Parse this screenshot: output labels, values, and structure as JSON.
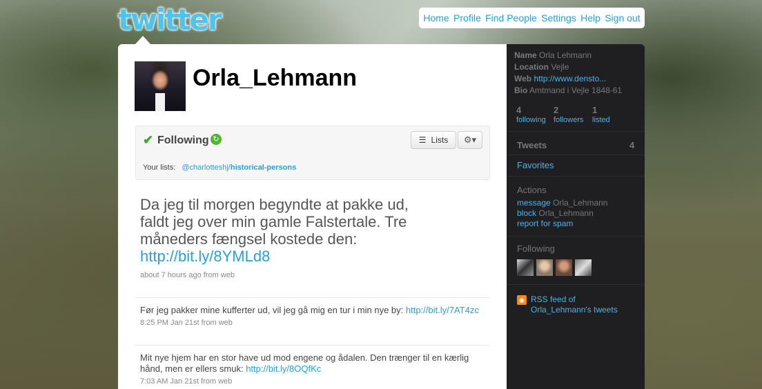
{
  "logo": "twitter",
  "nav": [
    "Home",
    "Profile",
    "Find People",
    "Settings",
    "Help",
    "Sign out"
  ],
  "profile": {
    "screen_name": "Orla_Lehmann"
  },
  "follow": {
    "status": "Following",
    "lists_button": "Lists",
    "your_lists_label": "Your lists:",
    "list_user": "@charlotteshj/",
    "list_name": "historical-persons"
  },
  "latest_tweet": {
    "text": "Da jeg til morgen begyndte at pakke ud, faldt jeg over min gamle Falstertale. Tre måneders fængsel kostede den: ",
    "link": "http://bit.ly/8YMLd8",
    "meta": "about 7 hours ago from web"
  },
  "tweets": [
    {
      "text": "Før jeg pakker mine kufferter ud, vil jeg gå mig en tur i min nye by: ",
      "link": "http://bit.ly/7AT4zc",
      "meta": "8:25 PM Jan 21st from web"
    },
    {
      "text": "Mit nye hjem har en stor have ud mod engene og ådalen. Den trænger til en kærlig hånd, men er ellers smuk: ",
      "link": "http://bit.ly/8OQfKc",
      "meta": "7:03 AM Jan 21st from web"
    }
  ],
  "sidebar": {
    "name_label": "Name",
    "name": "Orla Lehmann",
    "location_label": "Location",
    "location": "Vejle",
    "web_label": "Web",
    "web": "http://www.densto...",
    "bio_label": "Bio",
    "bio": "Amtmand i Vejle 1848-61",
    "stats": [
      {
        "count": "4",
        "label": "following"
      },
      {
        "count": "2",
        "label": "followers"
      },
      {
        "count": "1",
        "label": "listed"
      }
    ],
    "tweets_label": "Tweets",
    "tweets_count": "4",
    "favorites": "Favorites",
    "actions_title": "Actions",
    "message_link": "message",
    "message_target": "Orla_Lehmann",
    "block_link": "block",
    "block_target": "Orla_Lehmann",
    "report": "report for spam",
    "following_title": "Following",
    "rss_line1": "RSS feed of",
    "rss_line2": "Orla_Lehmann's tweets"
  },
  "colors": {
    "link": "#2b9fd8",
    "sidebar_bg": "#1f1f21",
    "logo": "#4fc3ea",
    "following_check": "#3aa829"
  }
}
